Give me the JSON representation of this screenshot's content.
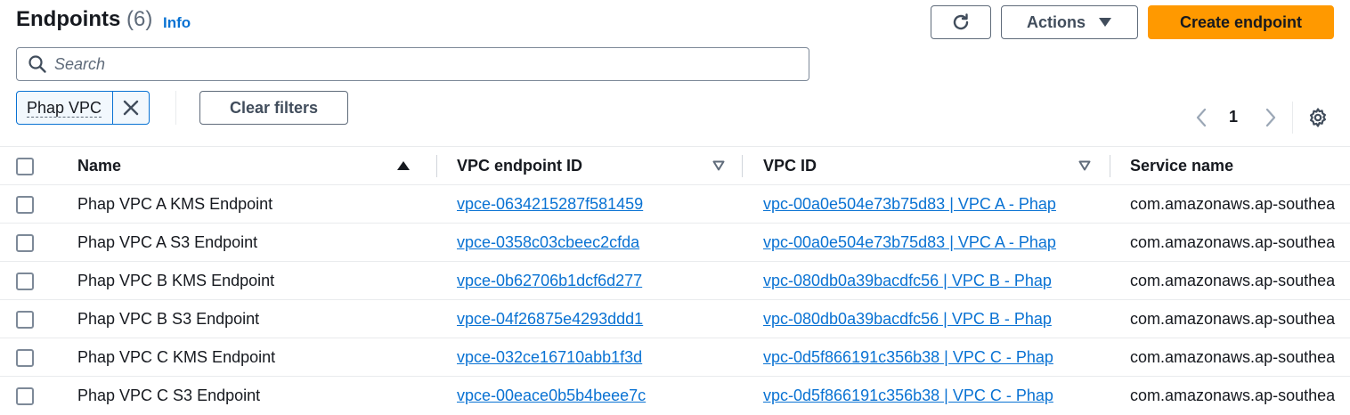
{
  "header": {
    "title": "Endpoints",
    "count": "(6)",
    "info_label": "Info",
    "actions_label": "Actions",
    "create_label": "Create endpoint"
  },
  "search": {
    "placeholder": "Search",
    "value": ""
  },
  "filters": {
    "token_label": "Phap VPC",
    "clear_label": "Clear filters"
  },
  "pagination": {
    "current_page": "1"
  },
  "table": {
    "columns": {
      "name": "Name",
      "endpoint_id": "VPC endpoint ID",
      "vpc_id": "VPC ID",
      "service_name": "Service name"
    },
    "rows": [
      {
        "name": "Phap VPC A KMS Endpoint",
        "endpoint_id": "vpce-0634215287f581459",
        "vpc_id": "vpc-00a0e504e73b75d83 | VPC A - Phap",
        "service_name": "com.amazonaws.ap-southea"
      },
      {
        "name": "Phap VPC A S3 Endpoint",
        "endpoint_id": "vpce-0358c03cbeec2cfda",
        "vpc_id": "vpc-00a0e504e73b75d83 | VPC A - Phap",
        "service_name": "com.amazonaws.ap-southea"
      },
      {
        "name": "Phap VPC B KMS Endpoint",
        "endpoint_id": "vpce-0b62706b1dcf6d277",
        "vpc_id": "vpc-080db0a39bacdfc56 | VPC B - Phap",
        "service_name": "com.amazonaws.ap-southea"
      },
      {
        "name": "Phap VPC B S3 Endpoint",
        "endpoint_id": "vpce-04f26875e4293ddd1",
        "vpc_id": "vpc-080db0a39bacdfc56 | VPC B - Phap",
        "service_name": "com.amazonaws.ap-southea"
      },
      {
        "name": "Phap VPC C KMS Endpoint",
        "endpoint_id": "vpce-032ce16710abb1f3d",
        "vpc_id": "vpc-0d5f866191c356b38 | VPC C - Phap",
        "service_name": "com.amazonaws.ap-southea"
      },
      {
        "name": "Phap VPC C S3 Endpoint",
        "endpoint_id": "vpce-00eace0b5b4beee7c",
        "vpc_id": "vpc-0d5f866191c356b38 | VPC C - Phap",
        "service_name": "com.amazonaws.ap-southea"
      }
    ]
  },
  "colors": {
    "accent": "#ff9900",
    "link": "#0972d3",
    "text": "#16191f"
  },
  "icons": [
    "refresh-icon",
    "caret-down-icon",
    "search-icon",
    "close-icon",
    "chevron-left-icon",
    "chevron-right-icon",
    "gear-icon",
    "sort-ascending-icon",
    "sort-descending-icon"
  ]
}
